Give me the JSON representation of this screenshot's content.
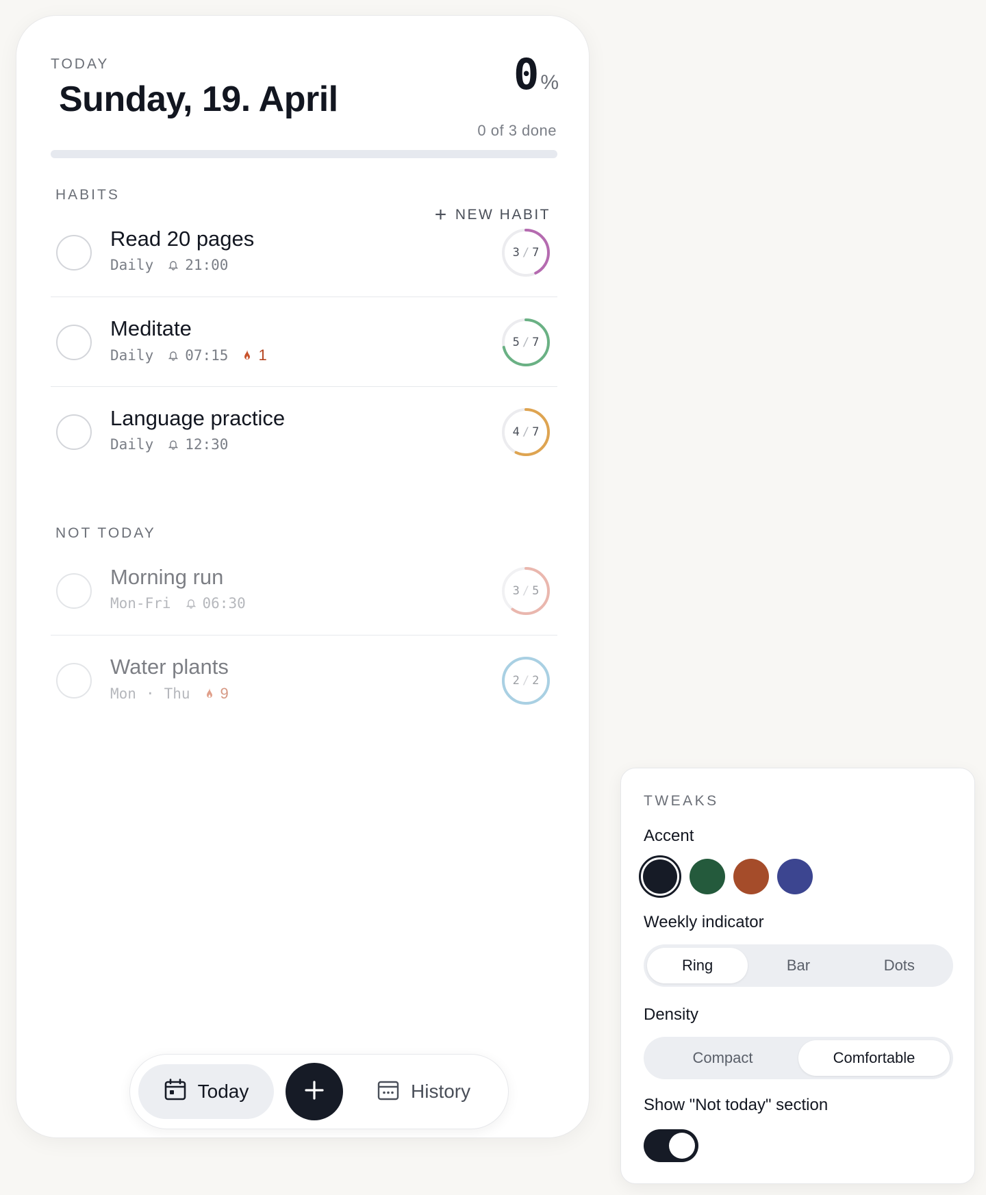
{
  "header": {
    "today_label": "TODAY",
    "date": "Sunday, 19. April",
    "percent": "0",
    "percent_sign": "%",
    "done_text": "0 of 3 done",
    "progress_fraction": 0
  },
  "habits": {
    "section_label": "HABITS",
    "new_habit_label": "NEW HABIT",
    "items": [
      {
        "name": "Read 20 pages",
        "schedule": "Daily",
        "time": "21:00",
        "done": "3",
        "total": "7",
        "color": "#b56bb0",
        "streak": ""
      },
      {
        "name": "Meditate",
        "schedule": "Daily",
        "time": "07:15",
        "done": "5",
        "total": "7",
        "color": "#6ab184",
        "streak": "1"
      },
      {
        "name": "Language practice",
        "schedule": "Daily",
        "time": "12:30",
        "done": "4",
        "total": "7",
        "color": "#dea451",
        "streak": ""
      }
    ]
  },
  "not_today": {
    "section_label": "NOT TODAY",
    "items": [
      {
        "name": "Morning run",
        "schedule": "Mon-Fri",
        "time": "06:30",
        "done": "3",
        "total": "5",
        "color": "#eab7ae",
        "streak": ""
      },
      {
        "name": "Water plants",
        "schedule_a": "Mon",
        "schedule_sep": "·",
        "schedule_b": "Thu",
        "done": "2",
        "total": "2",
        "color": "#a9d0e3",
        "streak": "9"
      }
    ]
  },
  "nav": {
    "today_label": "Today",
    "history_label": "History"
  },
  "tweaks": {
    "title": "TWEAKS",
    "accent_label": "Accent",
    "accent_colors": [
      "#161b26",
      "#245a3c",
      "#a54c2a",
      "#3c4590"
    ],
    "accent_selected": 0,
    "weekly_label": "Weekly indicator",
    "weekly_options": [
      "Ring",
      "Bar",
      "Dots"
    ],
    "weekly_selected": "Ring",
    "density_label": "Density",
    "density_options": [
      "Compact",
      "Comfortable"
    ],
    "density_selected": "Comfortable",
    "not_today_label": "Show \"Not today\" section",
    "not_today_enabled": true
  }
}
